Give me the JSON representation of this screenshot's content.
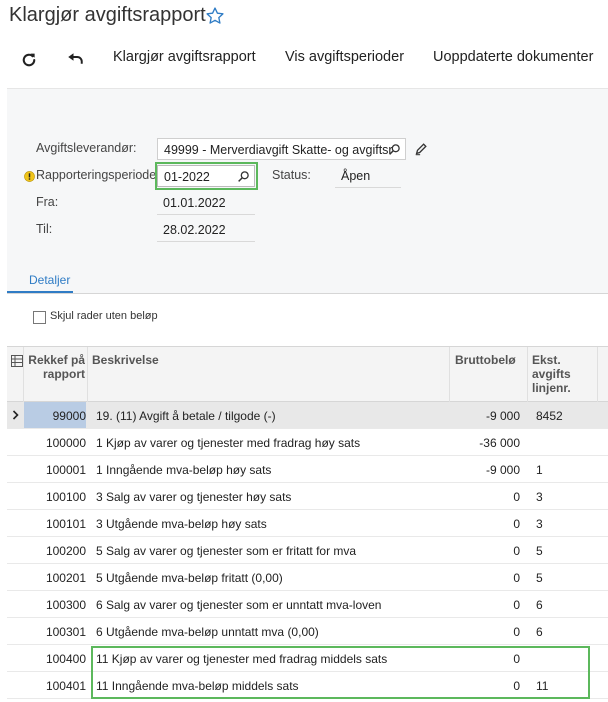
{
  "header": {
    "title": "Klargjør avgiftsrapport"
  },
  "toolbar": {
    "prepare_label": "Klargjør avgiftsrapport",
    "view_periods_label": "Vis avgiftsperioder",
    "unupdated_docs_label": "Uoppdaterte dokumenter"
  },
  "form": {
    "vendor_label": "Avgiftsleverandør:",
    "vendor_value": "49999 - Merverdiavgift Skatte- og avgiftsr",
    "period_label": "Rapporteringsperiode",
    "period_value": "01-2022",
    "status_label": "Status:",
    "status_value": "Åpen",
    "from_label": "Fra:",
    "from_value": "01.01.2022",
    "to_label": "Til:",
    "to_value": "28.02.2022"
  },
  "tabs": {
    "details": "Detaljer"
  },
  "filter": {
    "hide_zero_label": "Skjul rader uten beløp"
  },
  "grid": {
    "headers": {
      "line": "Rekkef på rapport",
      "description": "Beskrivelse",
      "gross": "Bruttobelø",
      "ext": "Ekst. avgifts linjenr."
    },
    "rows": [
      {
        "code": "99000",
        "desc": "19. (11) Avgift å betale / tilgode (-)",
        "amount": "-9 000",
        "ext": "8452"
      },
      {
        "code": "100000",
        "desc": "1 Kjøp av varer og tjenester med fradrag høy sats",
        "amount": "-36 000",
        "ext": ""
      },
      {
        "code": "100001",
        "desc": "1 Inngående mva-beløp høy sats",
        "amount": "-9 000",
        "ext": "1"
      },
      {
        "code": "100100",
        "desc": "3 Salg av varer og tjenester høy sats",
        "amount": "0",
        "ext": "3"
      },
      {
        "code": "100101",
        "desc": "3 Utgående mva-beløp høy sats",
        "amount": "0",
        "ext": "3"
      },
      {
        "code": "100200",
        "desc": "5 Salg av varer og tjenester som er fritatt for mva",
        "amount": "0",
        "ext": "5"
      },
      {
        "code": "100201",
        "desc": "5 Utgående mva-beløp fritatt (0,00)",
        "amount": "0",
        "ext": "5"
      },
      {
        "code": "100300",
        "desc": "6 Salg av varer og tjenester som er unntatt mva-loven",
        "amount": "0",
        "ext": "6"
      },
      {
        "code": "100301",
        "desc": "6 Utgående mva-beløp unntatt mva (0,00)",
        "amount": "0",
        "ext": "6"
      },
      {
        "code": "100400",
        "desc": "11 Kjøp av varer og tjenester med fradrag middels sats",
        "amount": "0",
        "ext": ""
      },
      {
        "code": "100401",
        "desc": "11 Inngående mva-beløp middels sats",
        "amount": "0",
        "ext": "11"
      }
    ]
  },
  "colors": {
    "accent": "#2f7cc5",
    "highlight": "#5cb85c",
    "selected_code": "#b9cce4",
    "warning": "#f0c419"
  }
}
